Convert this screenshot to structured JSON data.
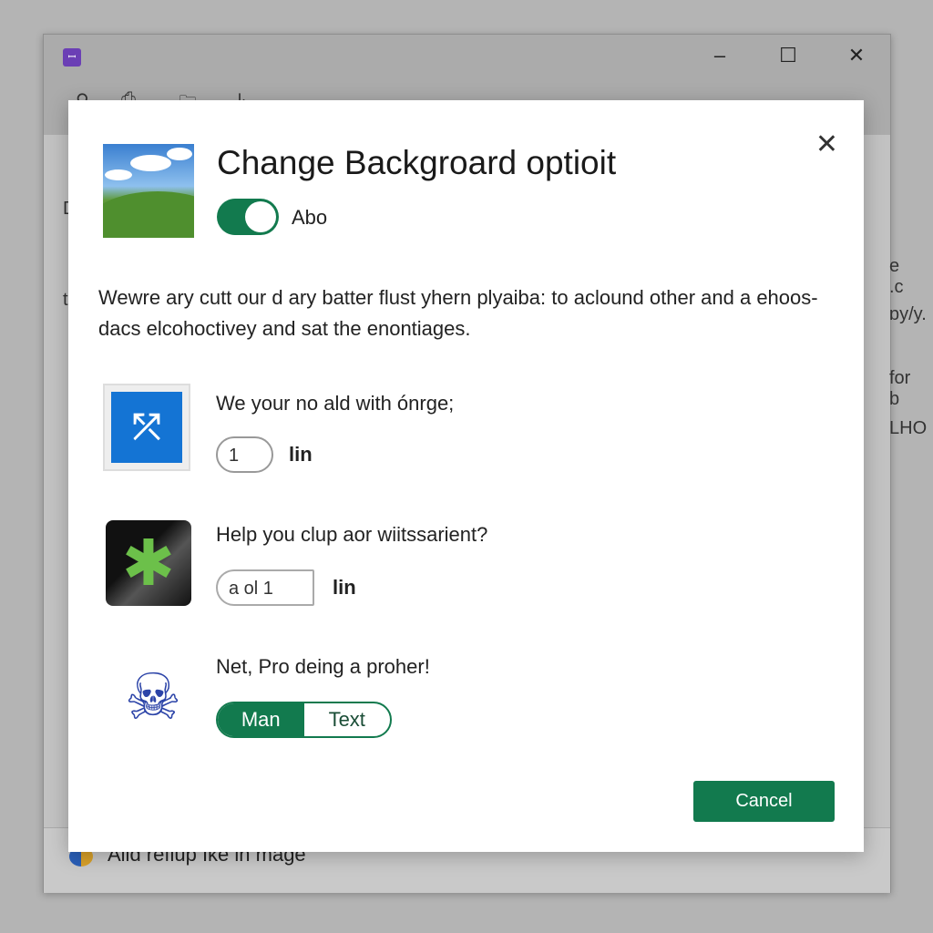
{
  "window": {
    "app_icon": "app-logo-icon",
    "minimize": "–",
    "maximize": "☐",
    "close": "✕"
  },
  "background": {
    "right_texts": [
      "e .c",
      "ɒy/y.",
      "for b",
      "LHO"
    ],
    "left_texts": [
      "D",
      "t"
    ],
    "footer_text": "Alld refiup Ike in mage"
  },
  "dialog": {
    "title": "Change Backgroard optioit",
    "toggle": {
      "label": "Abo",
      "on": true
    },
    "description": "Wewre ary cutt our d ary batter flust yhern plyaiba: to aclound other and a ehoos-dacs elcohoctivey and sat the enontiages.",
    "rows": [
      {
        "title": "We your no ald with ónrge;",
        "value": "1",
        "unit": "lin",
        "icon": "blue-tile-icon"
      },
      {
        "title": "Help you clup aor wiitssarient?",
        "value": "a ol 1",
        "unit": "lin",
        "icon": "green-star-icon"
      },
      {
        "title": "Net, Pro deing a proher!",
        "icon": "blue-head-icon",
        "segments": [
          "Man",
          "Text"
        ],
        "selected": "Man"
      }
    ],
    "cancel_label": "Cancel",
    "close": "✕"
  },
  "colors": {
    "accent": "#127a4e",
    "icon_blue": "#1474d4",
    "app_purple": "#6b3fb5"
  }
}
